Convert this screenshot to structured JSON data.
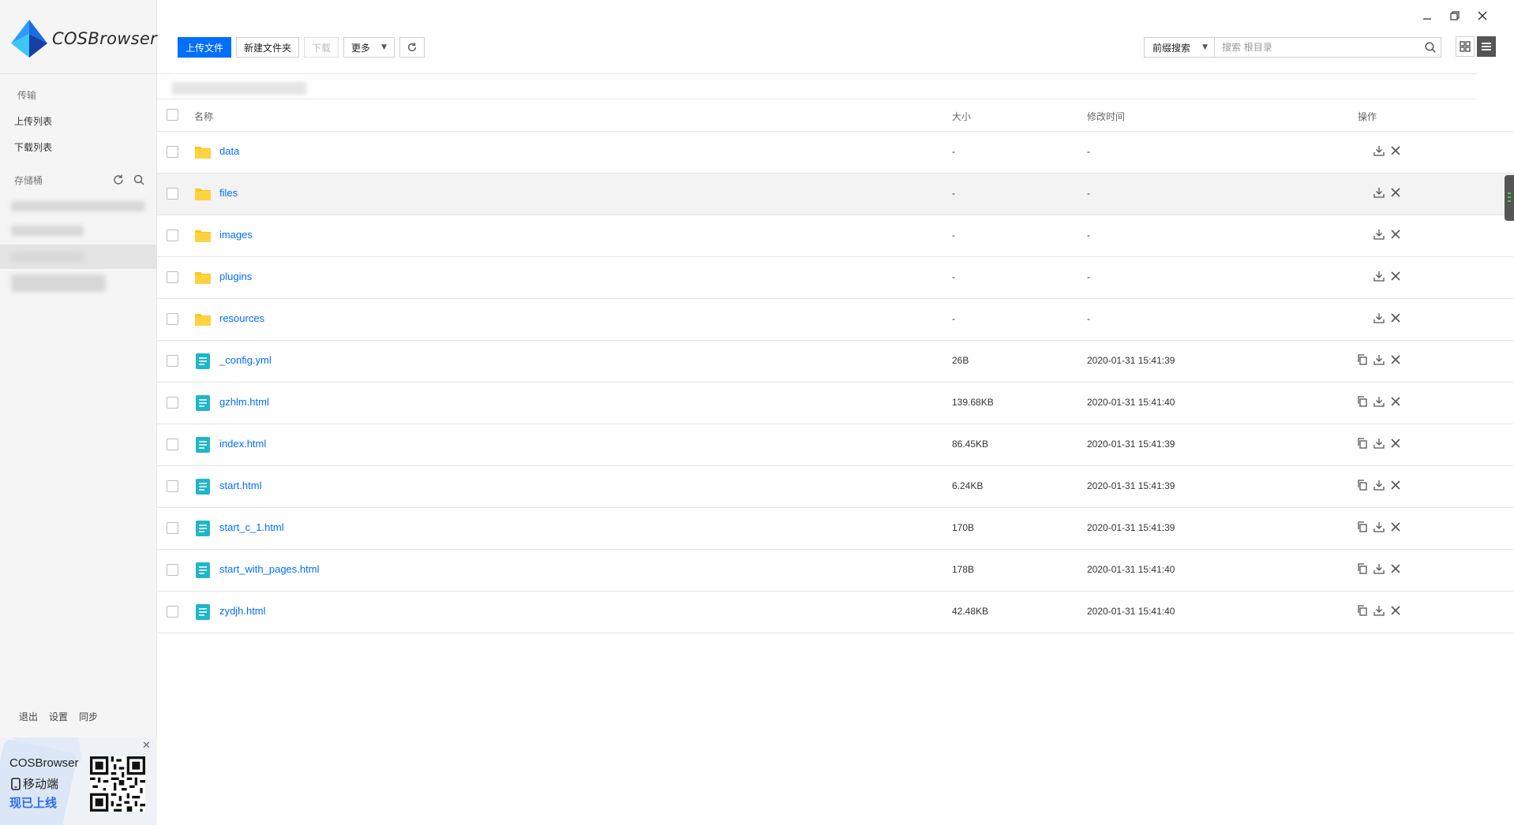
{
  "app": {
    "name": "COSBrowser"
  },
  "sidebar": {
    "section_transfer": "传输",
    "upload_list": "上传列表",
    "download_list": "下载列表",
    "section_buckets": "存储桶",
    "footer": {
      "logout": "退出",
      "settings": "设置",
      "sync": "同步"
    }
  },
  "promo": {
    "title": "COSBrowser",
    "line2": "移动端",
    "line3": "现已上线"
  },
  "toolbar": {
    "upload": "上传文件",
    "new_folder": "新建文件夹",
    "download": "下载",
    "more": "更多"
  },
  "search": {
    "mode": "前缀搜索",
    "placeholder": "搜索 根目录"
  },
  "table": {
    "headers": {
      "name": "名称",
      "size": "大小",
      "modified": "修改时间",
      "actions": "操作"
    },
    "rows": [
      {
        "type": "folder",
        "name": "data",
        "size": "-",
        "modified": "-"
      },
      {
        "type": "folder",
        "name": "files",
        "size": "-",
        "modified": "-"
      },
      {
        "type": "folder",
        "name": "images",
        "size": "-",
        "modified": "-"
      },
      {
        "type": "folder",
        "name": "plugins",
        "size": "-",
        "modified": "-"
      },
      {
        "type": "folder",
        "name": "resources",
        "size": "-",
        "modified": "-"
      },
      {
        "type": "file",
        "name": "_config.yml",
        "size": "26B",
        "modified": "2020-01-31 15:41:39"
      },
      {
        "type": "file",
        "name": "gzhlm.html",
        "size": "139.68KB",
        "modified": "2020-01-31 15:41:40"
      },
      {
        "type": "file",
        "name": "index.html",
        "size": "86.45KB",
        "modified": "2020-01-31 15:41:39"
      },
      {
        "type": "file",
        "name": "start.html",
        "size": "6.24KB",
        "modified": "2020-01-31 15:41:39"
      },
      {
        "type": "file",
        "name": "start_c_1.html",
        "size": "170B",
        "modified": "2020-01-31 15:41:39"
      },
      {
        "type": "file",
        "name": "start_with_pages.html",
        "size": "178B",
        "modified": "2020-01-31 15:41:40"
      },
      {
        "type": "file",
        "name": "zydjh.html",
        "size": "42.48KB",
        "modified": "2020-01-31 15:41:40"
      }
    ]
  },
  "colors": {
    "accent": "#006eff",
    "folder": "#ffc61a",
    "file": "#1fb6c9"
  }
}
